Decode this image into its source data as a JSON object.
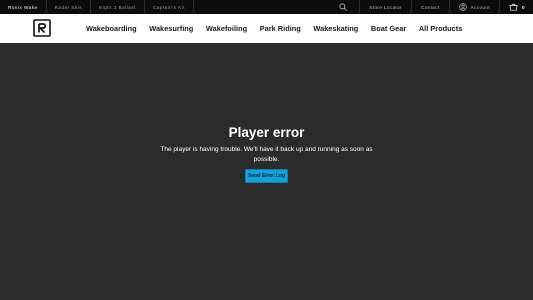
{
  "topbar": {
    "brands": [
      {
        "label": "Ronix Wake",
        "active": true
      },
      {
        "label": "Radar Skis",
        "active": false
      },
      {
        "label": "Eight.3 Ballast",
        "active": false
      },
      {
        "label": "Captain's Kit",
        "active": false
      }
    ],
    "store_locator": "Store Locator",
    "contact": "Contact",
    "account": "Account",
    "cart_count": "0"
  },
  "nav": {
    "links": [
      "Wakeboarding",
      "Wakesurfing",
      "Wakefoiling",
      "Park Riding",
      "Wakeskating",
      "Boat Gear",
      "All Products"
    ]
  },
  "player": {
    "title": "Player error",
    "message": "The player is having trouble. We'll have it back up and running as soon as possible.",
    "button": "Send Error Log"
  },
  "colors": {
    "topbar_bg": "#0c0c0c",
    "navbar_bg": "#ffffff",
    "player_bg": "#2b2b2b",
    "button_bg": "#16a0d8"
  },
  "icons": [
    "search-icon",
    "account-icon",
    "cart-icon",
    "ronix-logo"
  ]
}
